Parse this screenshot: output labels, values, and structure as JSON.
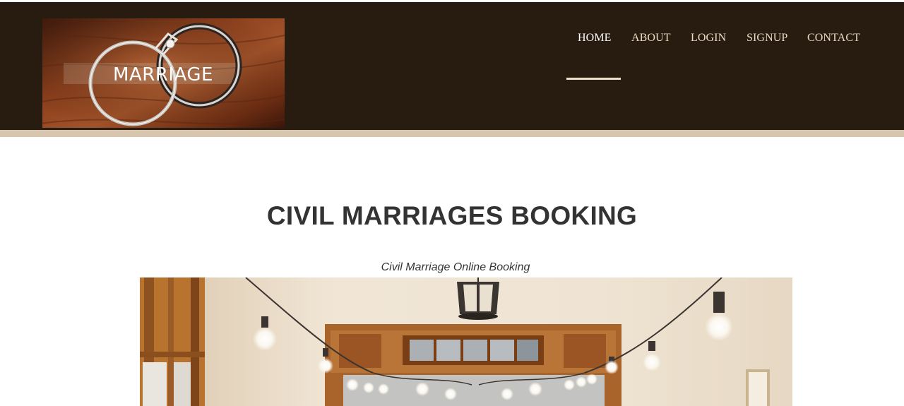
{
  "header": {
    "logo_text": "MARRIAGE",
    "nav": [
      {
        "label": "HOME",
        "active": true
      },
      {
        "label": "ABOUT",
        "active": false
      },
      {
        "label": "LOGIN",
        "active": false
      },
      {
        "label": "SIGNUP",
        "active": false
      },
      {
        "label": "CONTACT",
        "active": false
      }
    ]
  },
  "main": {
    "title": "CIVIL MARRIAGES BOOKING",
    "subtitle": "Civil Marriage Online Booking"
  },
  "colors": {
    "header_bg": "#281b10",
    "header_rule": "#d7c6ad",
    "nav_text": "#eadbc3",
    "nav_active": "#ffffff",
    "heading_text": "#333333"
  }
}
